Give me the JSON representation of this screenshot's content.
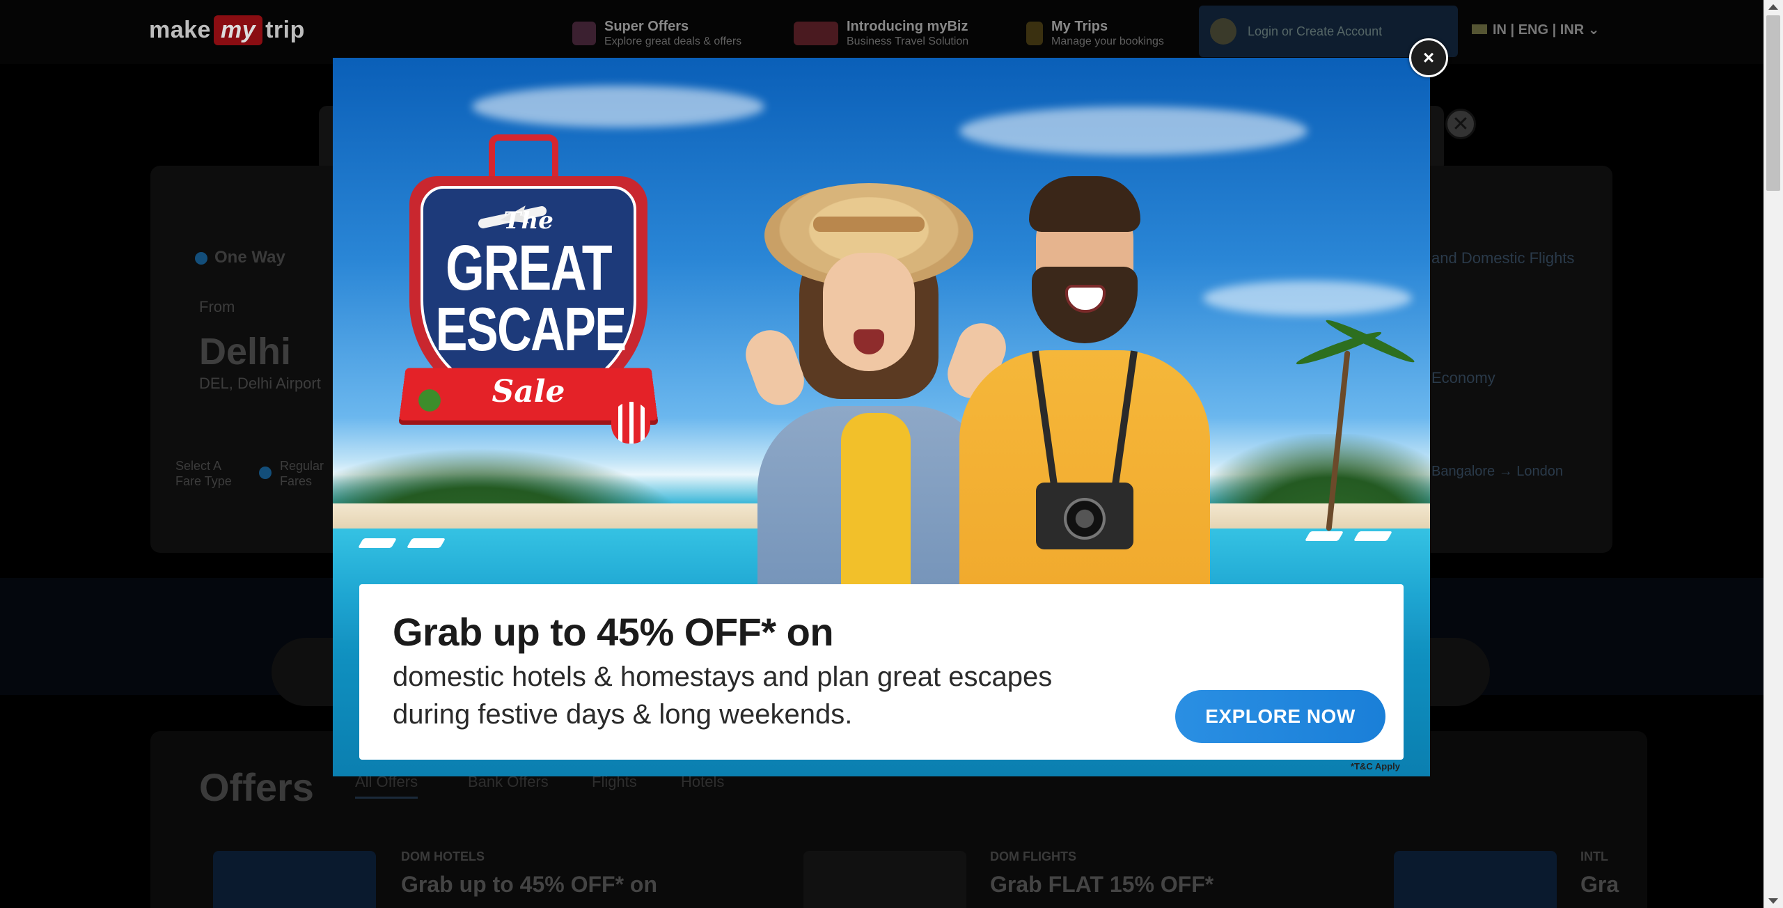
{
  "header": {
    "logo_text_left": "make",
    "logo_text_mid": "my",
    "logo_text_right": "trip",
    "nav": [
      {
        "title": "Super Offers",
        "subtitle": "Explore great deals & offers"
      },
      {
        "title": "Introducing myBiz",
        "subtitle": "Business Travel Solution"
      },
      {
        "title": "My Trips",
        "subtitle": "Manage your bookings"
      }
    ],
    "login_text": "Login or Create Account",
    "lang": "IN | ENG | INR"
  },
  "search": {
    "trip_type": "One Way",
    "from_label": "From",
    "from_city": "Delhi",
    "from_airport": "DEL, Delhi Airport",
    "fare_type_label": "Select A Fare Type",
    "fare_option": "Regular Fares",
    "right_text": "and Domestic Flights",
    "class_text": "Economy",
    "recent_search": "Bangalore → London"
  },
  "offers": {
    "title": "Offers",
    "tabs": [
      "All Offers",
      "Bank Offers",
      "Flights",
      "Hotels"
    ],
    "cards": [
      {
        "category": "DOM HOTELS",
        "headline": "Grab up to 45% OFF* on"
      },
      {
        "category": "DOM FLIGHTS",
        "headline": "Grab FLAT 15% OFF*"
      },
      {
        "category": "INTL",
        "headline": "Gra"
      }
    ]
  },
  "modal": {
    "badge_the": "The",
    "badge_great": "GREAT",
    "badge_escape": "ESCAPE",
    "badge_sale": "Sale",
    "headline": "Grab up to 45% OFF* on",
    "description_line1": "domestic hotels & homestays and plan great escapes",
    "description_line2": "during festive days & long weekends.",
    "cta": "EXPLORE NOW",
    "terms": "*T&C Apply",
    "close_symbol": "×"
  },
  "colors": {
    "cta_blue": "#2a8fe3",
    "badge_red": "#d6262f",
    "badge_navy": "#1d3a7a"
  }
}
